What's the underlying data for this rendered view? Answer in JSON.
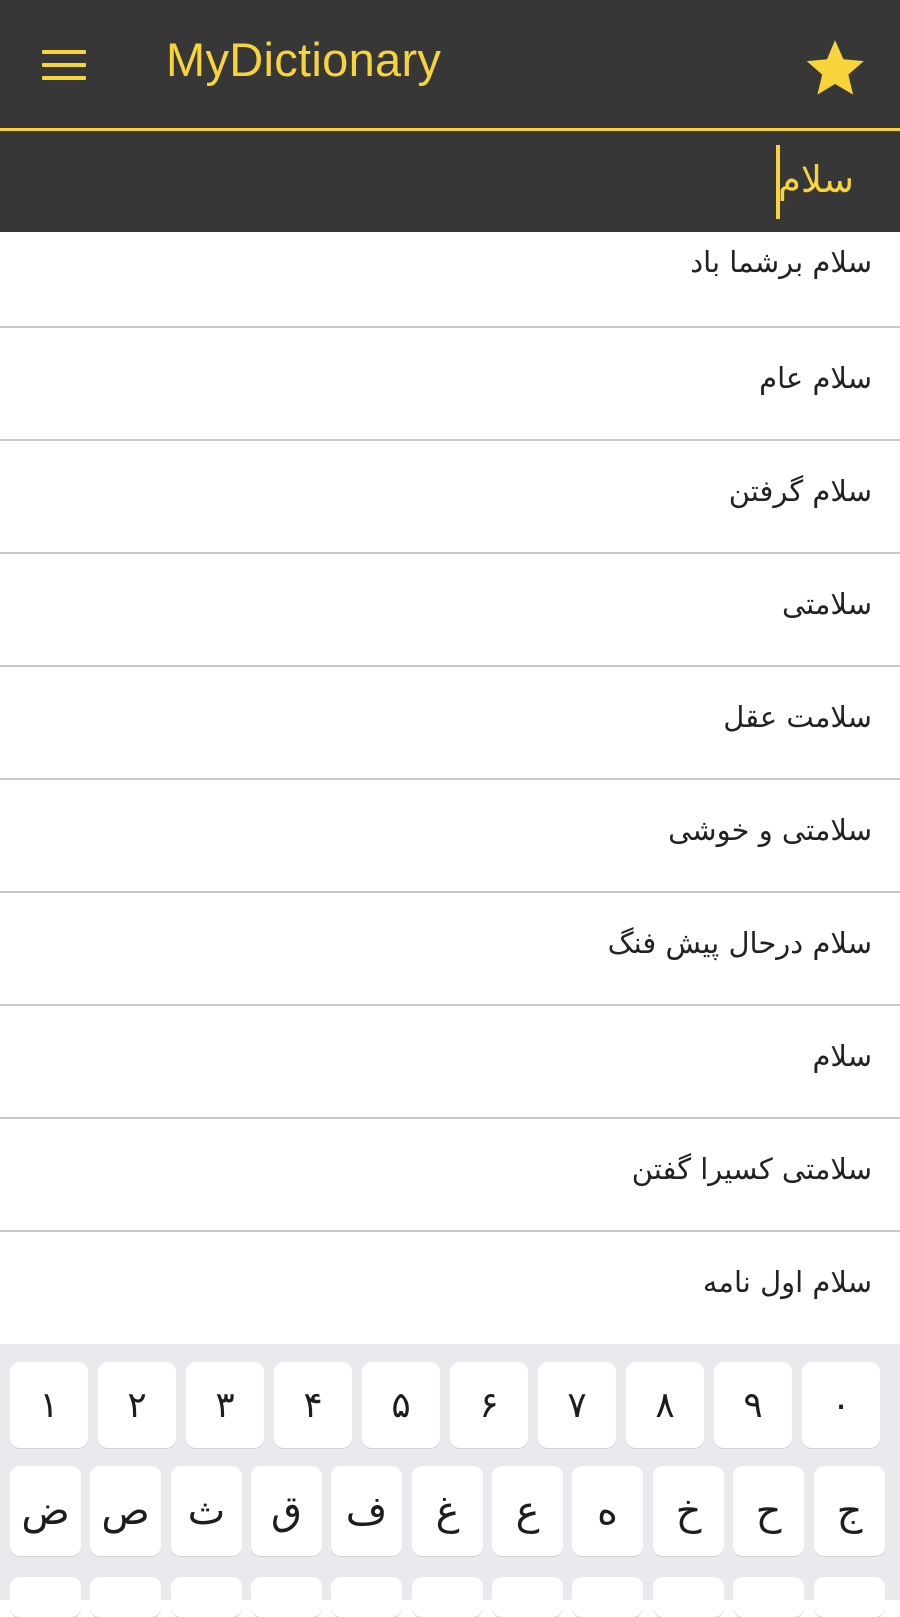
{
  "app": {
    "title": "MyDictionary",
    "icons": {
      "menu": "hamburger-menu-icon",
      "favorites": "star-icon"
    },
    "colors": {
      "accent": "#f6d43a",
      "toolbar": "#373737",
      "keyboard_bg": "#e9eaee"
    }
  },
  "search": {
    "value": "سلام"
  },
  "results": [
    {
      "word": "سلام برشما باد"
    },
    {
      "word": "سلام عام"
    },
    {
      "word": "سلام گرفتن"
    },
    {
      "word": "سلامتی"
    },
    {
      "word": "سلامت عقل"
    },
    {
      "word": "سلامتی و خوشی"
    },
    {
      "word": "سلام درحال پیش فنگ"
    },
    {
      "word": "سلام"
    },
    {
      "word": "سلامتی کسیرا گفتن"
    },
    {
      "word": "سلام اول نامه"
    }
  ],
  "keyboard": {
    "number_row": [
      "۱",
      "۲",
      "۳",
      "۴",
      "۵",
      "۶",
      "۷",
      "۸",
      "۹",
      "۰"
    ],
    "letter_row": [
      "ض",
      "ص",
      "ث",
      "ق",
      "ف",
      "غ",
      "ع",
      "ه",
      "خ",
      "ح",
      "ج"
    ]
  }
}
